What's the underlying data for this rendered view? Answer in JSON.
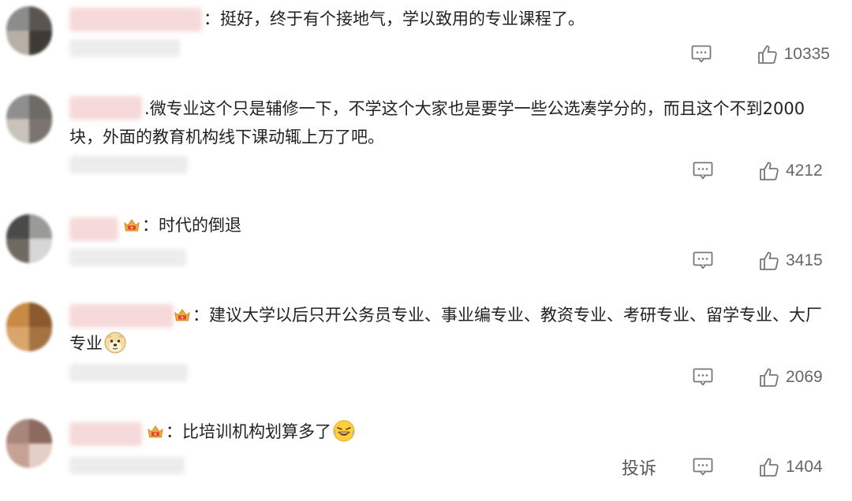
{
  "comments": [
    {
      "separator": "：",
      "text": "挺好，终于有个接地气，学以致用的专业课程了。",
      "likes": "10335",
      "has_crown": false
    },
    {
      "separator": ".",
      "text": "微专业这个只是辅修一下，不学这个大家也是要学一些公选凑学分的，而且这个不到2000块，外面的教育机构线下课动辄上万了吧。",
      "likes": "4212",
      "has_crown": false
    },
    {
      "separator": "：",
      "text": "时代的倒退",
      "likes": "3415",
      "has_crown": true
    },
    {
      "separator": "：",
      "text": "建议大学以后只开公务员专业、事业编专业、教资专业、考研专业、留学专业、大厂专业",
      "likes": "2069",
      "has_crown": true,
      "emoji": "doge-emoji"
    },
    {
      "separator": "：",
      "text": "比培训机构划算多了",
      "likes": "1404",
      "has_crown": true,
      "emoji": "laugh-cry-emoji",
      "report_label": "投诉"
    }
  ],
  "icons": {
    "comment": "comment-icon",
    "like": "thumbs-up-icon",
    "crown": "crown-badge-icon"
  },
  "colors": {
    "text": "#222222",
    "meta": "#666666",
    "crown": "#e8a33a",
    "blur_name": "#f6d9d9"
  }
}
